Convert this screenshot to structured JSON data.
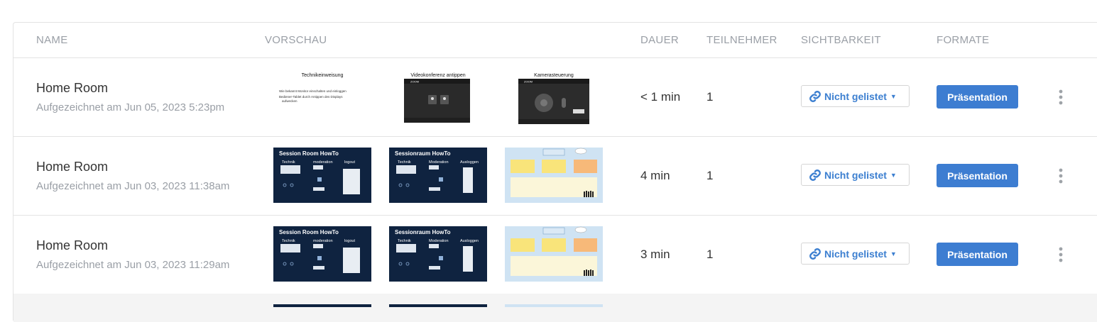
{
  "headers": {
    "name": "NAME",
    "preview": "VORSCHAU",
    "duration": "DAUER",
    "participants": "TEILNEHMER",
    "visibility": "SICHTBARKEIT",
    "formats": "FORMATE"
  },
  "rows": [
    {
      "title": "Home Room",
      "recorded": "Aufgezeichnet am Jun 05, 2023 5:23pm",
      "duration": "< 1 min",
      "participants": "1",
      "visibility": "Nicht gelistet",
      "format": "Präsentation",
      "previews": [
        {
          "caption": "Technikeinweisung",
          "bullet1": "Wie bekannt Monitor einschalten und einloggen",
          "bullet2": "Bediener-Tablet durch Antippen des Displays",
          "bullet3": "aufwecken"
        },
        {
          "caption": "Videokonferenz antippen",
          "brand": "ZOOM"
        },
        {
          "caption": "Kamerasteuerung",
          "brand": "ZOOM"
        }
      ]
    },
    {
      "title": "Home Room",
      "recorded": "Aufgezeichnet am Jun 03, 2023 11:38am",
      "duration": "4 min",
      "participants": "1",
      "visibility": "Nicht gelistet",
      "format": "Präsentation",
      "previews": [
        {
          "title": "Session Room HowTo",
          "c1": "Technik",
          "c2": "moderation",
          "c3": "logout"
        },
        {
          "title": "Sessionraum HowTo",
          "c1": "Technik",
          "c2": "Moderation",
          "c3": "Ausloggen"
        },
        {
          "kind": "board"
        }
      ]
    },
    {
      "title": "Home Room",
      "recorded": "Aufgezeichnet am Jun 03, 2023 11:29am",
      "duration": "3 min",
      "participants": "1",
      "visibility": "Nicht gelistet",
      "format": "Präsentation",
      "previews": [
        {
          "title": "Session Room HowTo",
          "c1": "Technik",
          "c2": "moderation",
          "c3": "logout"
        },
        {
          "title": "Sessionraum HowTo",
          "c1": "Technik",
          "c2": "Moderation",
          "c3": "Ausloggen"
        },
        {
          "kind": "board"
        }
      ]
    }
  ],
  "colors": {
    "accent": "#3d7dd1",
    "link": "#3c7fd0",
    "slide_dark": "#0f2340",
    "board_bg": "#cfe3f3",
    "note_yellow": "#f9e47a",
    "note_orange": "#f7b979"
  },
  "icons": {
    "visibility": "link-icon",
    "more": "vertical-ellipsis-icon"
  }
}
